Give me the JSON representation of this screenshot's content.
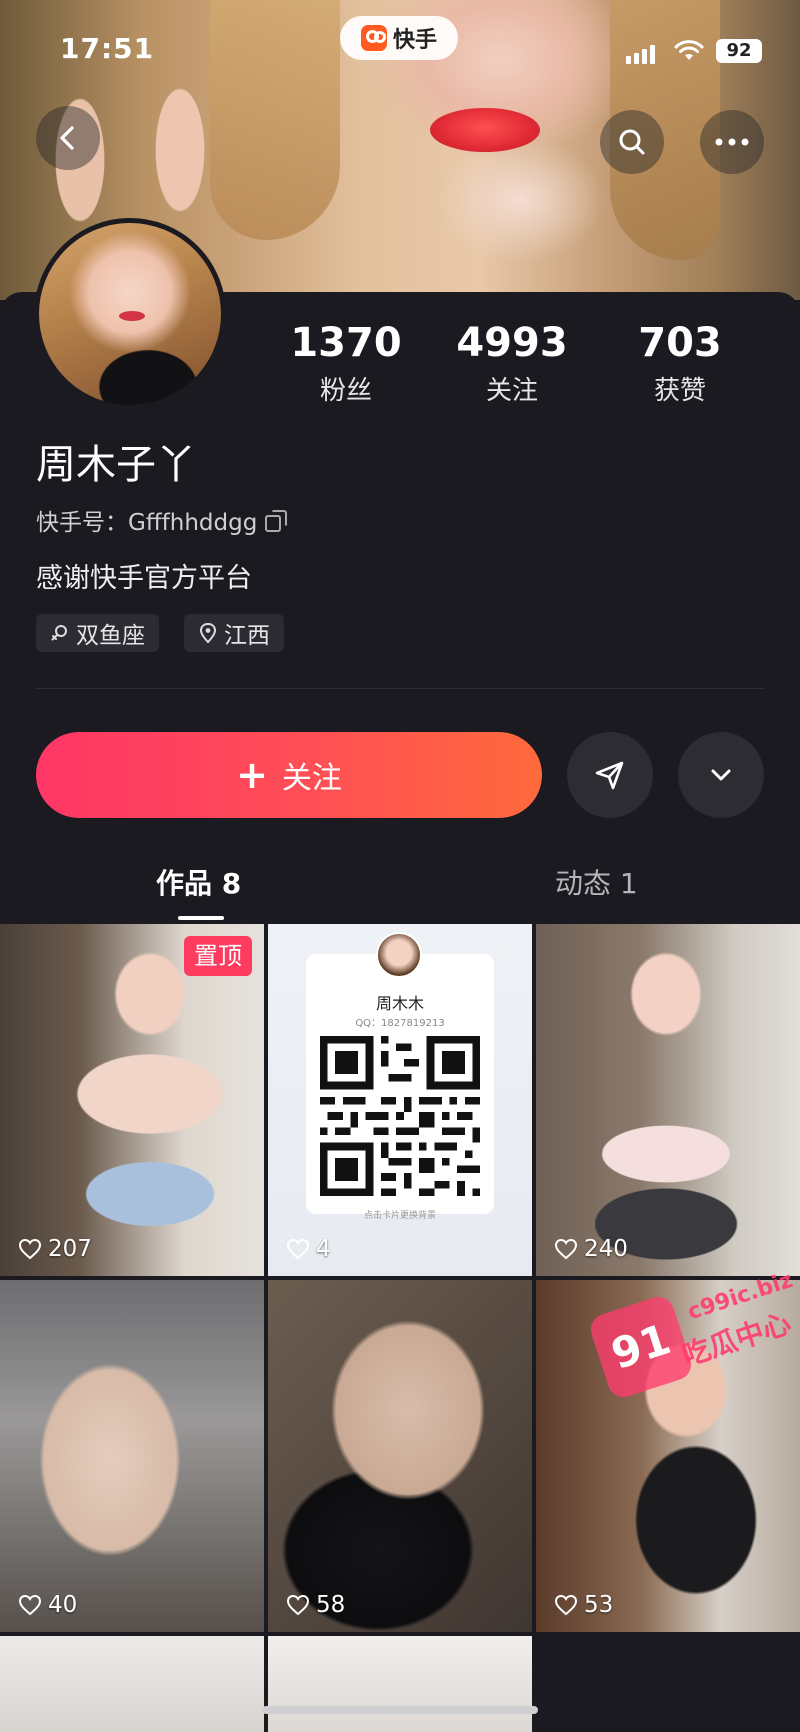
{
  "status_bar": {
    "time": "17:51",
    "battery": "92"
  },
  "app": {
    "name": "快手"
  },
  "profile": {
    "name": "周木子丫",
    "kuaishou_id": "快手号：Gfffhhddgg",
    "bio": "感谢快手官方平台",
    "tags": [
      {
        "icon": "zodiac-icon",
        "label": "双鱼座"
      },
      {
        "icon": "location-pin-icon",
        "label": "江西"
      }
    ],
    "stats": [
      {
        "value": "1370",
        "label": "粉丝"
      },
      {
        "value": "4993",
        "label": "关注"
      },
      {
        "value": "703",
        "label": "获赞"
      }
    ]
  },
  "actions": {
    "follow_label": "关注",
    "follow_symbol": "+"
  },
  "tabs": [
    {
      "label": "作品 8",
      "active": true
    },
    {
      "label": "动态 1",
      "active": false
    }
  ],
  "posts": [
    {
      "likes": "207",
      "badge": "置顶"
    },
    {
      "likes": "4",
      "qr_name": "周木木",
      "qr_qq": "QQ：1827819213",
      "qr_hint": "点击卡片更换背景"
    },
    {
      "likes": "240"
    },
    {
      "likes": "40"
    },
    {
      "likes": "58"
    },
    {
      "likes": "53"
    },
    {
      "likes": ""
    },
    {
      "likes": ""
    }
  ],
  "watermark": {
    "badge": "91",
    "url": "c99ic.biz",
    "text": "吃瓜中心"
  },
  "colors": {
    "accent_gradient_start": "#fe3666",
    "accent_gradient_end": "#ff6a3c",
    "background": "#1b1a20",
    "pin_badge": "#fe3c60"
  }
}
